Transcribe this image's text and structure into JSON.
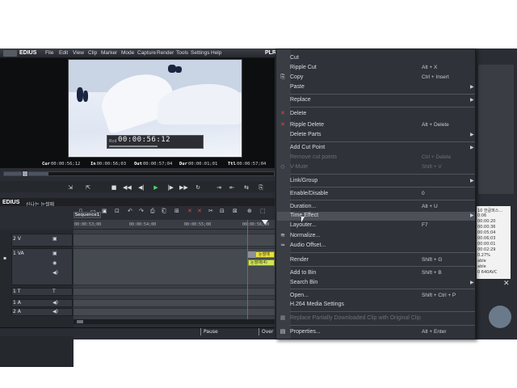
{
  "app": {
    "name": "EDIUS",
    "menu": [
      "File",
      "Edit",
      "View",
      "Clip",
      "Marker",
      "Mode",
      "Capture",
      "Render",
      "Tools",
      "Settings",
      "Help"
    ],
    "player_label": "PLR"
  },
  "player": {
    "overlay_timecode_label": "Rcd",
    "overlay_timecode": "00:00:56:12",
    "timecodes": [
      {
        "label": "Cur",
        "value": "00:00:56;12"
      },
      {
        "label": "In",
        "value": "00:00:56;03"
      },
      {
        "label": "Out",
        "value": "00:00:57;04"
      },
      {
        "label": "Dur",
        "value": "00:00:01;01"
      },
      {
        "label": "Ttl",
        "value": "00:00:57;04"
      }
    ]
  },
  "timeline": {
    "app_label": "EDIUS",
    "project_name": "신나는 눈썰매",
    "sequence_tab": "Sequence1",
    "ruler_ticks": [
      "00:00:53;00",
      "00:00:54;00",
      "00:00:55;00",
      "00:00:56;00"
    ],
    "tracks": [
      {
        "name": "2 V"
      },
      {
        "name": "1 VA"
      },
      {
        "name": "1 T"
      },
      {
        "name": "1 A"
      },
      {
        "name": "2 A"
      }
    ],
    "clip_labels": [
      "눈썰매",
      "눈썰매(4)"
    ]
  },
  "status": {
    "pause": "Pause",
    "over": "Over"
  },
  "right_panel": {
    "list_items": [
      "10 한글퍼스...",
      "0:06",
      "00:00:20",
      "00:00:36",
      "00:05;04",
      "00:06;03",
      "00:00:01",
      "00:02:29",
      "0.27%",
      "able",
      "able",
      "0 640AVC"
    ]
  },
  "context_menu": {
    "items": [
      {
        "label": "Cut",
        "shortcut": "",
        "submenu": false,
        "disabled": false,
        "icon": ""
      },
      {
        "label": "Ripple Cut",
        "shortcut": "Alt + X",
        "submenu": false,
        "disabled": false,
        "icon": ""
      },
      {
        "label": "Copy",
        "shortcut": "Ctrl + Insert",
        "submenu": false,
        "disabled": false,
        "icon": "copy"
      },
      {
        "label": "Paste",
        "shortcut": "",
        "submenu": true,
        "disabled": false,
        "icon": ""
      },
      {
        "label": "Replace",
        "shortcut": "",
        "submenu": true,
        "disabled": false,
        "icon": ""
      },
      {
        "label": "Delete",
        "shortcut": "",
        "submenu": false,
        "disabled": false,
        "icon": "delete"
      },
      {
        "label": "Ripple Delete",
        "shortcut": "Alt + Delete",
        "submenu": false,
        "disabled": false,
        "icon": "ripple-delete"
      },
      {
        "label": "Delete Parts",
        "shortcut": "",
        "submenu": true,
        "disabled": false,
        "icon": ""
      },
      {
        "label": "Add Cut Point",
        "shortcut": "",
        "submenu": true,
        "disabled": false,
        "icon": ""
      },
      {
        "label": "Remove cut points",
        "shortcut": "Ctrl + Delete",
        "submenu": false,
        "disabled": true,
        "icon": ""
      },
      {
        "label": "V-Mute",
        "shortcut": "Shift + V",
        "submenu": false,
        "disabled": true,
        "icon": "vmute"
      },
      {
        "label": "Link/Group",
        "shortcut": "",
        "submenu": true,
        "disabled": false,
        "icon": ""
      },
      {
        "label": "Enable/Disable",
        "shortcut": "0",
        "submenu": false,
        "disabled": false,
        "icon": ""
      },
      {
        "label": "Duration...",
        "shortcut": "Alt + U",
        "submenu": false,
        "disabled": false,
        "icon": ""
      },
      {
        "label": "Time Effect",
        "shortcut": "",
        "submenu": true,
        "disabled": false,
        "icon": "",
        "highlighted": true
      },
      {
        "label": "Layouter...",
        "shortcut": "F7",
        "submenu": false,
        "disabled": false,
        "icon": ""
      },
      {
        "label": "Normalize...",
        "shortcut": "",
        "submenu": false,
        "disabled": false,
        "icon": "normalize"
      },
      {
        "label": "Audio Offset...",
        "shortcut": "",
        "submenu": false,
        "disabled": false,
        "icon": "audio-offset"
      },
      {
        "label": "Render",
        "shortcut": "Shift + G",
        "submenu": false,
        "disabled": false,
        "icon": ""
      },
      {
        "label": "Add to Bin",
        "shortcut": "Shift + B",
        "submenu": false,
        "disabled": false,
        "icon": ""
      },
      {
        "label": "Search Bin",
        "shortcut": "",
        "submenu": true,
        "disabled": false,
        "icon": ""
      },
      {
        "label": "Open...",
        "shortcut": "Shift + Ctrl + P",
        "submenu": false,
        "disabled": false,
        "icon": ""
      },
      {
        "label": "H.264 Media Settings",
        "shortcut": "",
        "submenu": false,
        "disabled": false,
        "icon": ""
      },
      {
        "label": "Replace Partially Downloaded Clip with Original Clip",
        "shortcut": "",
        "submenu": false,
        "disabled": true,
        "icon": "replace-clip"
      },
      {
        "label": "Properties...",
        "shortcut": "Alt + Enter",
        "submenu": false,
        "disabled": false,
        "icon": "properties"
      }
    ]
  }
}
